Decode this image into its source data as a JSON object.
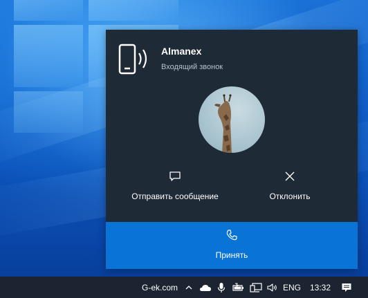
{
  "toast": {
    "caller_name": "Almanex",
    "status": "Входящий звонок",
    "actions": {
      "send_message": "Отправить сообщение",
      "decline": "Отклонить",
      "accept": "Принять"
    },
    "icons": {
      "header": "phone-ringing-icon",
      "send_message": "chat-bubble-icon",
      "decline": "close-icon",
      "accept": "phone-icon"
    }
  },
  "taskbar": {
    "site_label": "G-ek.com",
    "tray_icons": [
      "chevron-up-icon",
      "onedrive-cloud-icon",
      "microphone-icon",
      "battery-icon",
      "network-icon",
      "volume-icon"
    ],
    "language": "ENG",
    "time": "13:32",
    "notification_icon": "action-center-icon"
  },
  "colors": {
    "toast_bg": "#1f2a37",
    "accept_bg": "#0a74d6",
    "taskbar_bg": "#1b2430"
  }
}
